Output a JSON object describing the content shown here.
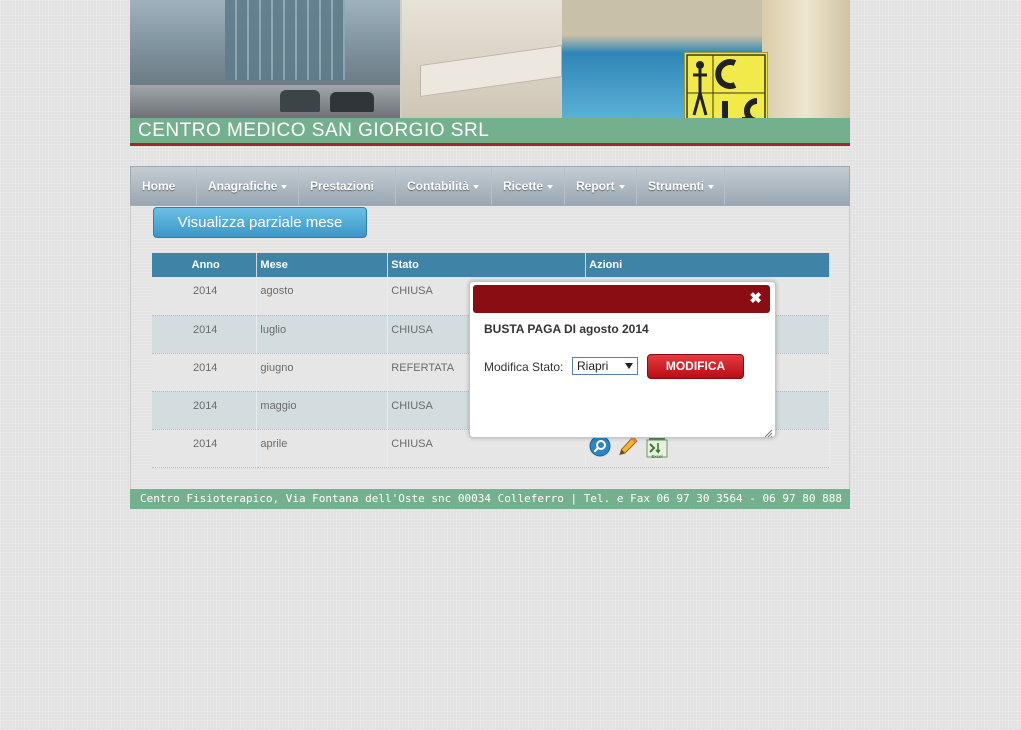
{
  "header": {
    "title": "CENTRO MEDICO SAN GIORGIO SRL"
  },
  "nav": {
    "items": [
      {
        "label": "Home",
        "dropdown": false
      },
      {
        "label": "Anagrafiche",
        "dropdown": true
      },
      {
        "label": "Prestazioni",
        "dropdown": false
      },
      {
        "label": "Contabilità",
        "dropdown": true
      },
      {
        "label": "Ricette",
        "dropdown": true
      },
      {
        "label": "Report",
        "dropdown": true
      },
      {
        "label": "Strumenti",
        "dropdown": true
      }
    ]
  },
  "main": {
    "view_button": "Visualizza parziale mese",
    "table": {
      "headers": [
        "Anno",
        "Mese",
        "Stato",
        "Azioni"
      ],
      "rows": [
        {
          "anno": "2014",
          "mese": "agosto",
          "stato": "CHIUSA"
        },
        {
          "anno": "2014",
          "mese": "luglio",
          "stato": "CHIUSA"
        },
        {
          "anno": "2014",
          "mese": "giugno",
          "stato": "REFERTATA"
        },
        {
          "anno": "2014",
          "mese": "maggio",
          "stato": "CHIUSA"
        },
        {
          "anno": "2014",
          "mese": "aprile",
          "stato": "CHIUSA"
        }
      ],
      "action_icons": [
        "search-icon",
        "pencil-icon",
        "excel-export-icon"
      ],
      "excel_icon_text": "Excel"
    }
  },
  "footer": {
    "text": "Centro Fisioterapico, Via Fontana dell'Oste snc 00034 Colleferro | Tel. e Fax 06 97 30 3564 - 06 97 80 888"
  },
  "modal": {
    "close_symbol": "✖",
    "title": "BUSTA PAGA DI agosto 2014",
    "field_label": "Modifica Stato:",
    "select_value": "Riapri",
    "submit_label": "MODIFICA"
  },
  "colors": {
    "header_green": "#74b08e",
    "table_header": "#3f83a6",
    "modal_header": "#8b0d14",
    "modal_button": "#c8141b",
    "view_button": "#4aa7d6"
  }
}
